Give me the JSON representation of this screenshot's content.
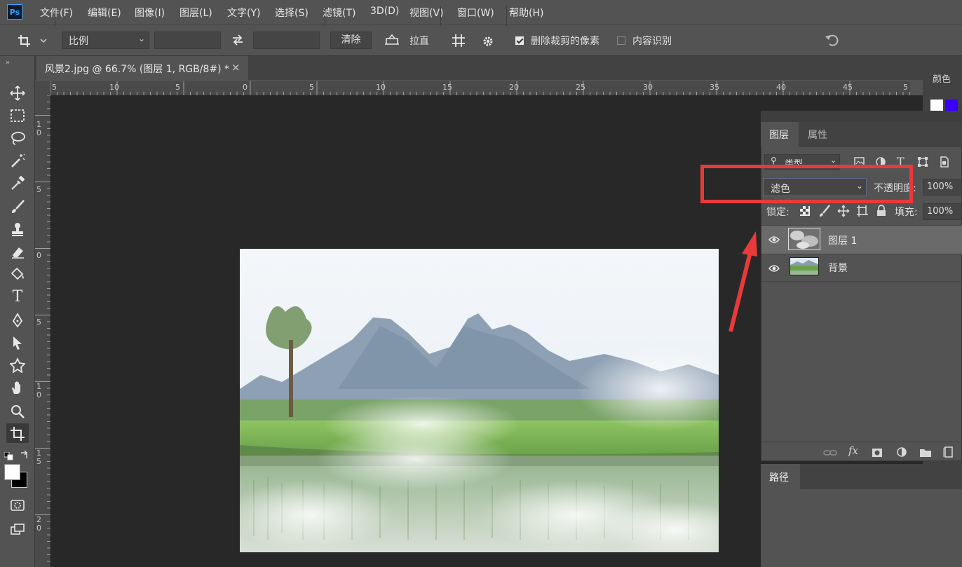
{
  "app": {
    "logo": "Ps"
  },
  "menu": [
    "文件(F)",
    "编辑(E)",
    "图像(I)",
    "图层(L)",
    "文字(Y)",
    "选择(S)",
    "滤镜(T)",
    "3D(D)",
    "视图(V)",
    "窗口(W)",
    "帮助(H)"
  ],
  "options": {
    "ratio_select": "比例",
    "clear_button": "清除",
    "straighten_label": "拉直",
    "delete_cropped": "删除裁剪的像素",
    "content_aware": "内容识别",
    "delete_cropped_checked": true,
    "content_aware_checked": false
  },
  "document": {
    "tab_title": "风景2.jpg @ 66.7% (图层 1, RGB/8#) *",
    "close_glyph": "×"
  },
  "ruler": {
    "h_labels": [
      "5",
      "10",
      "5",
      "0",
      "5",
      "10",
      "15",
      "20",
      "25",
      "30",
      "35",
      "40",
      "45",
      "5"
    ],
    "v_labels": [
      "1\n0",
      "5",
      "0",
      "5",
      "1\n0",
      "1\n5",
      "2\n0"
    ]
  },
  "panels": {
    "color_title": "颜色",
    "layers_tab": "图层",
    "properties_tab": "属性",
    "filter_kind": "类型",
    "blend_mode": "滤色",
    "opacity_label": "不透明度:",
    "opacity_value": "100%",
    "lock_label": "锁定:",
    "fill_label": "填充:",
    "fill_value": "100%",
    "layers": [
      {
        "name": "图层 1",
        "selected": true
      },
      {
        "name": "背景",
        "selected": false
      }
    ],
    "paths_tab": "路径",
    "fx_label": "fx"
  },
  "colors": {
    "foreground": "#ffffff",
    "background": "#000000",
    "swatch_blue": "#3a00ff",
    "highlight": "#e83a3a"
  },
  "icons": [
    "crop-icon",
    "swap-icon",
    "grid-icon",
    "gear-icon",
    "undo-icon",
    "move-icon",
    "marquee-icon",
    "lasso-icon",
    "magic-wand-icon",
    "eyedropper-icon",
    "brush-icon",
    "stamp-icon",
    "eraser-icon",
    "paint-bucket-icon",
    "type-icon",
    "pen-icon",
    "path-select-icon",
    "shape-icon",
    "hand-icon",
    "zoom-icon",
    "crop-tool-icon",
    "eye-icon",
    "link-icon",
    "folder-icon"
  ]
}
